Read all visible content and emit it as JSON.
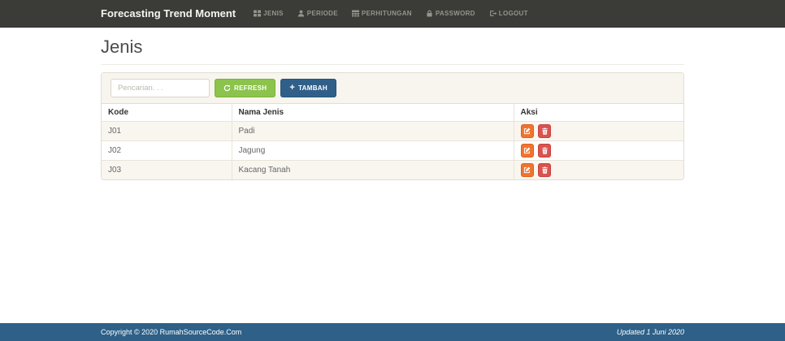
{
  "navbar": {
    "brand": "Forecasting Trend Moment",
    "items": [
      {
        "label": "JENIS",
        "icon": "th-large-icon"
      },
      {
        "label": "PERIODE",
        "icon": "user-icon"
      },
      {
        "label": "PERHITUNGAN",
        "icon": "table-icon"
      },
      {
        "label": "PASSWORD",
        "icon": "lock-icon"
      },
      {
        "label": "LOGOUT",
        "icon": "logout-icon"
      }
    ]
  },
  "page": {
    "title": "Jenis"
  },
  "toolbar": {
    "search_placeholder": "Pencarian. . .",
    "refresh_label": "REFRESH",
    "refresh_icon": "refresh-icon",
    "tambah_label": "TAMBAH",
    "tambah_icon": "plus-icon",
    "plus_glyph": "+"
  },
  "table": {
    "headers": [
      "Kode",
      "Nama Jenis",
      "Aksi"
    ],
    "rows": [
      {
        "kode": "J01",
        "nama": "Padi"
      },
      {
        "kode": "J02",
        "nama": "Jagung"
      },
      {
        "kode": "J03",
        "nama": "Kacang Tanah"
      }
    ],
    "row_actions": [
      "edit-icon",
      "trash-icon"
    ]
  },
  "footer": {
    "copyright": "Copyright © 2020 RumahSourceCode.Com",
    "updated": "Updated 1 Juni 2020"
  },
  "colors": {
    "navbar_bg": "#3b3b37",
    "panel_heading_bg": "#f8f5ef",
    "stripe_row_bg": "#f9f6ef",
    "refresh_green": "#8bc34c",
    "tambah_navy": "#30608a",
    "edit_orange": "#f0732f",
    "delete_red": "#d9534f",
    "footer_blue": "#2e6088"
  }
}
